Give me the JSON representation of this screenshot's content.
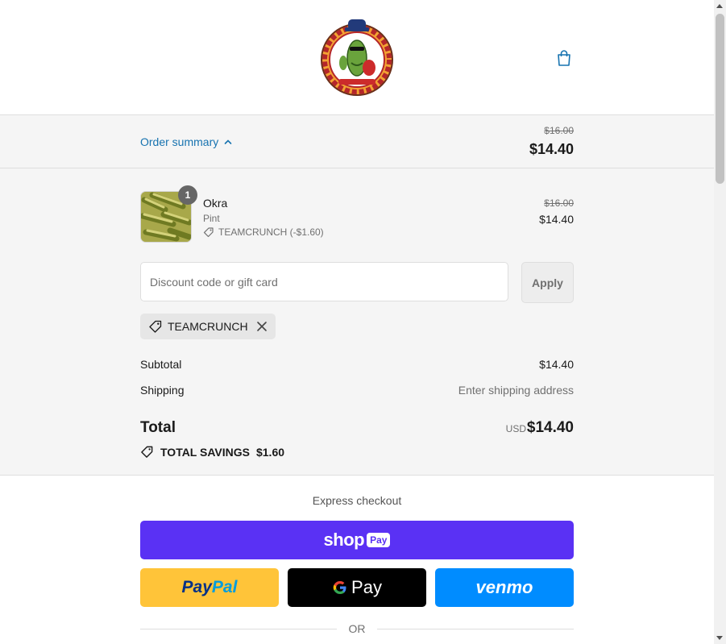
{
  "header": {
    "logo_text": "PICKLE GUY'S",
    "cart_icon": "shopping-bag-icon"
  },
  "summary_toggle": {
    "label": "Order summary",
    "original_price": "$16.00",
    "price": "$14.40"
  },
  "line_items": [
    {
      "name": "Okra",
      "variant": "Pint",
      "quantity": "1",
      "discount": "TEAMCRUNCH (-$1.60)",
      "original_price": "$16.00",
      "price": "$14.40"
    }
  ],
  "discount": {
    "placeholder": "Discount code or gift card",
    "value": "",
    "apply_label": "Apply",
    "applied_code": "TEAMCRUNCH"
  },
  "totals": {
    "subtotal_label": "Subtotal",
    "subtotal_value": "$14.40",
    "shipping_label": "Shipping",
    "shipping_value": "Enter shipping address",
    "total_label": "Total",
    "currency": "USD",
    "total_value": "$14.40",
    "savings_label": "TOTAL SAVINGS",
    "savings_value": "$1.60"
  },
  "express": {
    "title": "Express checkout",
    "shop_label": "shop",
    "shop_pay_badge": "Pay",
    "paypal_label_1": "Pay",
    "paypal_label_2": "Pal",
    "gpay_label": "Pay",
    "venmo_label": "venmo",
    "or_label": "OR"
  },
  "colors": {
    "accent": "#1773b0",
    "shop_pay": "#5a31f4",
    "paypal": "#ffc439",
    "venmo": "#008cff",
    "summary_bg": "#f5f5f5"
  }
}
